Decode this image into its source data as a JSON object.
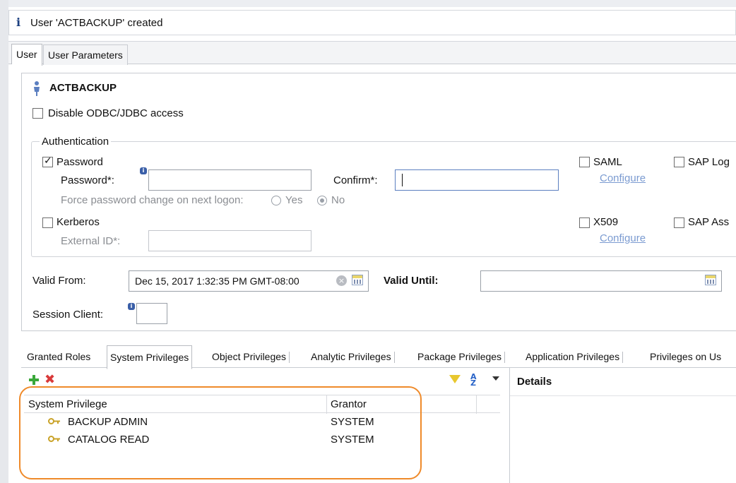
{
  "message": {
    "text": "User 'ACTBACKUP' created"
  },
  "tabs": [
    {
      "label": "User"
    },
    {
      "label": "User Parameters"
    }
  ],
  "user": {
    "name": "ACTBACKUP",
    "disable_odbc_label": "Disable ODBC/JDBC access",
    "authentication": {
      "legend": "Authentication",
      "password_label": "Password",
      "password_field_label": "Password*:",
      "confirm_label": "Confirm*:",
      "force_change_label": "Force password change on next logon:",
      "yes_label": "Yes",
      "no_label": "No",
      "kerberos_label": "Kerberos",
      "external_id_label": "External ID*:",
      "saml_label": "SAML",
      "sap_logon_label": "SAP Log",
      "x509_label": "X509",
      "sap_assertion_label": "SAP Ass",
      "configure_label": "Configure"
    },
    "valid_from_label": "Valid From:",
    "valid_from_value": "Dec 15, 2017 1:32:35 PM GMT-08:00",
    "valid_until_label": "Valid Until:",
    "session_client_label": "Session Client:"
  },
  "privilege_tabs": [
    {
      "label": "Granted Roles"
    },
    {
      "label": "System Privileges"
    },
    {
      "label": "Object Privileges"
    },
    {
      "label": "Analytic Privileges"
    },
    {
      "label": "Package Privileges"
    },
    {
      "label": "Application Privileges"
    },
    {
      "label": "Privileges on Us"
    }
  ],
  "privileges_table": {
    "headers": {
      "privilege": "System Privilege",
      "grantor": "Grantor"
    },
    "rows": [
      {
        "privilege": "BACKUP ADMIN",
        "grantor": "SYSTEM"
      },
      {
        "privilege": "CATALOG READ",
        "grantor": "SYSTEM"
      }
    ]
  },
  "details": {
    "title": "Details"
  },
  "colors": {
    "highlight": "#ef8a2a",
    "link": "#7b9bd1",
    "info": "#1c3f80"
  }
}
